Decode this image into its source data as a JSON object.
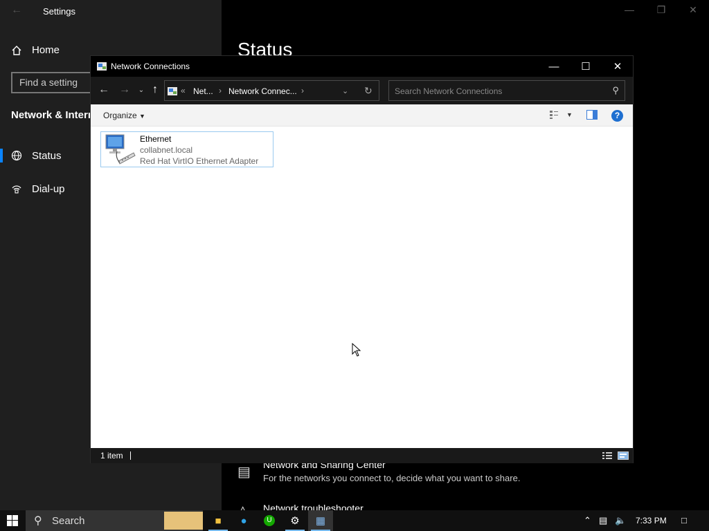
{
  "settings": {
    "title": "Settings",
    "home": "Home",
    "search_placeholder": "Find a setting",
    "section": "Network & Internet",
    "nav": [
      {
        "label": "Status",
        "icon": "globe-icon",
        "active": true
      },
      {
        "label": "Dial-up",
        "icon": "dialup-icon",
        "active": false
      }
    ],
    "page_title": "Status",
    "links": [
      {
        "title": "Network and Sharing Center",
        "desc": "For the networks you connect to, decide what you want to share.",
        "icon": "sharing-center-icon"
      },
      {
        "title": "Network troubleshooter",
        "icon": "warning-icon"
      }
    ]
  },
  "nc": {
    "title": "Network Connections",
    "address": {
      "crumbs": [
        "Net...",
        "Network Connec..."
      ]
    },
    "search_placeholder": "Search Network Connections",
    "organize": "Organize",
    "items": [
      {
        "name": "Ethernet",
        "domain": "collabnet.local",
        "adapter": "Red Hat VirtIO Ethernet Adapter"
      }
    ],
    "status": "1 item"
  },
  "taskbar": {
    "search": "Search",
    "time": "7:33 PM",
    "accent": "#76b9ed"
  }
}
